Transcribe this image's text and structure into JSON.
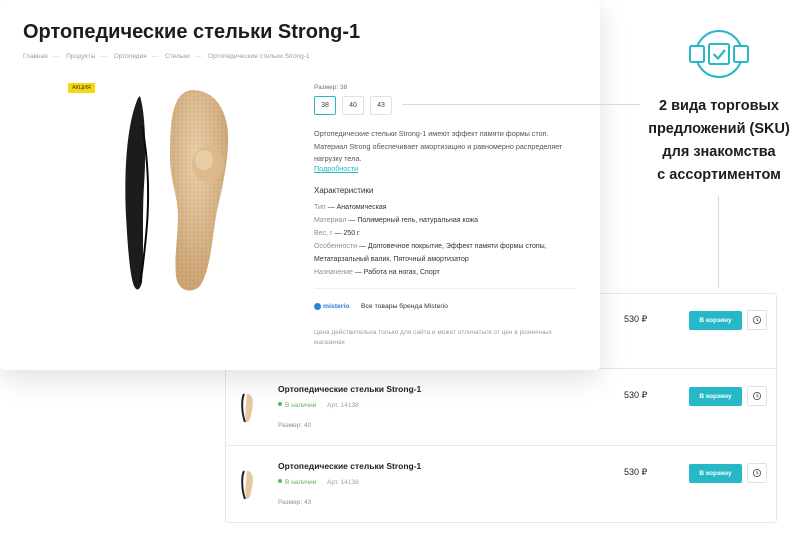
{
  "product": {
    "title": "Ортопедические стельки Strong-1",
    "badge": "АКЦИЯ",
    "breadcrumbs": [
      "Главная",
      "Продукты",
      "Ортопедия",
      "Стельки",
      "Ортопедические стельки Strong-1"
    ],
    "size_label": "Размер: 38",
    "sizes": [
      "38",
      "40",
      "43"
    ],
    "selected_size": "38",
    "description": "Ортопедические стельки Strong-1 имеют эффект памяти формы стоп. Материал Strong обеспечивает амортизацию и равномерно распределяет нагрузку тела.",
    "more_link": "Подробности",
    "characteristics_title": "Характеристики",
    "characteristics": [
      {
        "key": "Тип",
        "value": "Анатомическая"
      },
      {
        "key": "Материал",
        "value": "Полимерный гель, натуральная кожа"
      },
      {
        "key": "Вес, г",
        "value": "250 г"
      },
      {
        "key": "Особенности",
        "value": "Долговечное покрытие, Эффект памяти формы стопы, Метатарзальный валик, Пяточный амортизатор"
      },
      {
        "key": "Назначение",
        "value": "Работа на ногах, Спорт"
      }
    ],
    "brand_name": "misterio",
    "brand_link": "Все товары бренда Misterio",
    "note": "Цена действительна только для сайта и может отличаться от цен в розничных магазинах"
  },
  "sku": {
    "rows": [
      {
        "name": "",
        "stock": "",
        "article": "",
        "size": "",
        "price": "530 ₽",
        "cart": "В корзину"
      },
      {
        "name": "Ортопедические стельки Strong-1",
        "stock": "В наличии",
        "article": "Арт. 14138",
        "size": "Размер: 40",
        "price": "530 ₽",
        "cart": "В корзину"
      },
      {
        "name": "Ортопедические стельки Strong-1",
        "stock": "В наличии",
        "article": "Арт. 14138",
        "size": "Размер: 43",
        "price": "530 ₽",
        "cart": "В корзину"
      }
    ]
  },
  "callout": {
    "text_lines": [
      "2 вида торговых",
      "предложений (SKU)",
      "для знакомства",
      "с ассортиментом"
    ],
    "icon": "checkbox-options-icon",
    "accent_color": "#26b8c6"
  },
  "colors": {
    "accent": "#26b8c6",
    "badge": "#f5d90a",
    "in_stock": "#5cb85c",
    "brand": "#2f7fd8"
  }
}
